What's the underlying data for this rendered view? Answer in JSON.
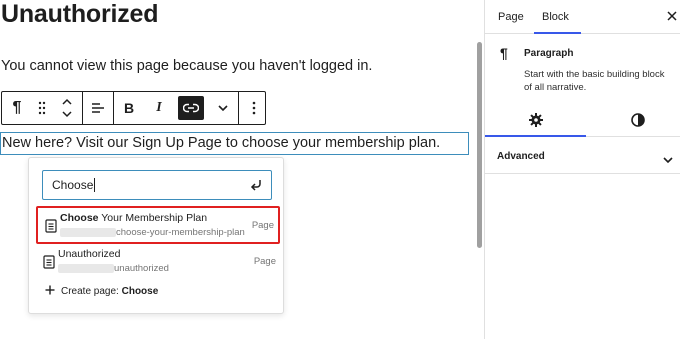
{
  "editor": {
    "title": "Unauthorized",
    "paragraph": "You cannot view this page because you haven't logged in.",
    "selected_block_text": "New here? Visit our Sign Up Page to choose your membership plan."
  },
  "toolbar": {
    "paragraph_icon": "pilcrow-icon",
    "buttons": [
      "drag-handle-icon",
      "move-up-down-icon",
      "align-icon",
      "bold",
      "italic",
      "link",
      "more-rich-text",
      "options"
    ],
    "bold_label": "B",
    "italic_label": "I"
  },
  "link_popover": {
    "search_value": "Choose",
    "suggestions": [
      {
        "title_bold": "Choose",
        "title_rest": " Your Membership Plan",
        "url_suffix": "choose-your-membership-plan",
        "type": "Page",
        "highlighted": true
      },
      {
        "title_bold": "",
        "title_rest": "Unauthorized",
        "url_suffix": "unauthorized",
        "type": "Page",
        "highlighted": false
      }
    ],
    "create_prefix": "Create page:",
    "create_term": "Choose"
  },
  "sidebar": {
    "tabs": [
      "Page",
      "Block"
    ],
    "active_tab": "Block",
    "block_card": {
      "icon": "pilcrow-icon",
      "title": "Paragraph",
      "description": "Start with the basic building block of all narrative."
    },
    "style_tabs": [
      "settings-gear-icon",
      "styles-contrast-icon"
    ],
    "panels": [
      "Advanced"
    ]
  },
  "colors": {
    "accent": "#3858e9",
    "focus_border": "#3d8dbb",
    "highlight_outline": "#e02020",
    "text": "#1e1e1e",
    "muted": "#757575"
  }
}
